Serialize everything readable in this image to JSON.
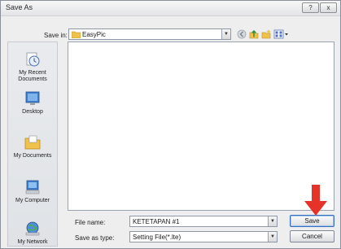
{
  "window": {
    "title": "Save As",
    "help_label": "?",
    "close_label": "x"
  },
  "save_in": {
    "label": "Save in:",
    "value": "EasyPic"
  },
  "toolbar": {
    "icons": [
      "back-icon",
      "up-folder-icon",
      "new-folder-icon",
      "views-menu-icon"
    ]
  },
  "places": {
    "items": [
      {
        "label": "My Recent\nDocuments",
        "icon": "recent-documents-icon"
      },
      {
        "label": "Desktop",
        "icon": "desktop-icon"
      },
      {
        "label": "My Documents",
        "icon": "my-documents-icon"
      },
      {
        "label": "My Computer",
        "icon": "my-computer-icon"
      },
      {
        "label": "My Network",
        "icon": "my-network-icon"
      }
    ]
  },
  "file_list": {
    "items": []
  },
  "file_name": {
    "label": "File name:",
    "value": "KETETAPAN #1"
  },
  "save_type": {
    "label": "Save as type:",
    "value": "Setting File(*.lte)"
  },
  "buttons": {
    "save": "Save",
    "cancel": "Cancel"
  },
  "colors": {
    "dialog_bg": "#eeeeef",
    "annotation_arrow": "#e5332a",
    "folder": "#f1c24b"
  }
}
